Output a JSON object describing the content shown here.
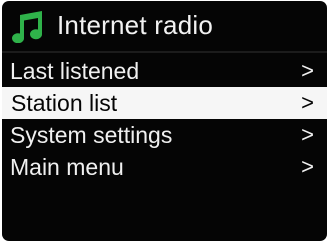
{
  "header": {
    "title": "Internet radio",
    "icon": "music-note-icon",
    "accent_color": "#2fb24a"
  },
  "menu": {
    "items": [
      {
        "label": "Last listened",
        "chevron": ">",
        "selected": false
      },
      {
        "label": "Station list",
        "chevron": ">",
        "selected": true
      },
      {
        "label": "System settings",
        "chevron": ">",
        "selected": false
      },
      {
        "label": "Main menu",
        "chevron": ">",
        "selected": false
      }
    ]
  }
}
